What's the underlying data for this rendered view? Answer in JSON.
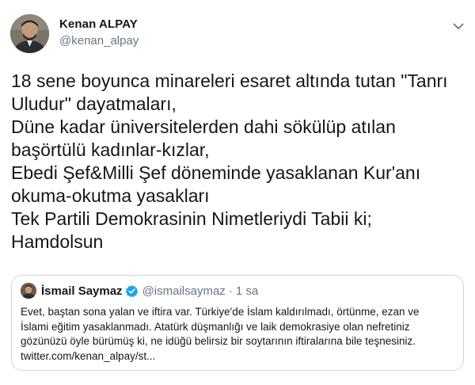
{
  "author": {
    "name": "Kenan ALPAY",
    "handle": "@kenan_alpay"
  },
  "tweet": {
    "lines": [
      "18 sene boyunca minareleri esaret altında tutan \"Tanrı",
      "Uludur\" dayatmaları,",
      "Düne kadar üniversitelerden dahi sökülüp atılan",
      "başörtülü kadınlar-kızlar,",
      "Ebedi Şef&Milli Şef döneminde yasaklanan Kur'anı",
      "okuma-okutma yasakları",
      "Tek Partili Demokrasinin Nimetleriydi Tabii ki;",
      "Hamdolsun"
    ]
  },
  "quoted": {
    "name": "İsmail Saymaz",
    "handle": "@ismailsaymaz",
    "separator": "·",
    "time": "1 sa",
    "lines": [
      "Evet, baştan sona yalan ve iftira var. Türkiye'de İslam kaldırılmadı, örtünme, ezan ve",
      "İslami eğitim yasaklanmadı. Atatürk düşmanlığı ve laik demokrasiye olan nefretiniz",
      "gözünüzü öyle bürümüş ki, ne idüğü belirsiz bir soytarının iftiralarına bile teşnesiniz.",
      "twitter.com/kenan_alpay/st..."
    ]
  },
  "icons": {
    "more": "chevron-down-icon",
    "verified": "verified-badge-icon"
  },
  "colors": {
    "text": "#14171a",
    "secondary": "#657786",
    "verified": "#1da1f2",
    "border": "#ccd6dd"
  }
}
